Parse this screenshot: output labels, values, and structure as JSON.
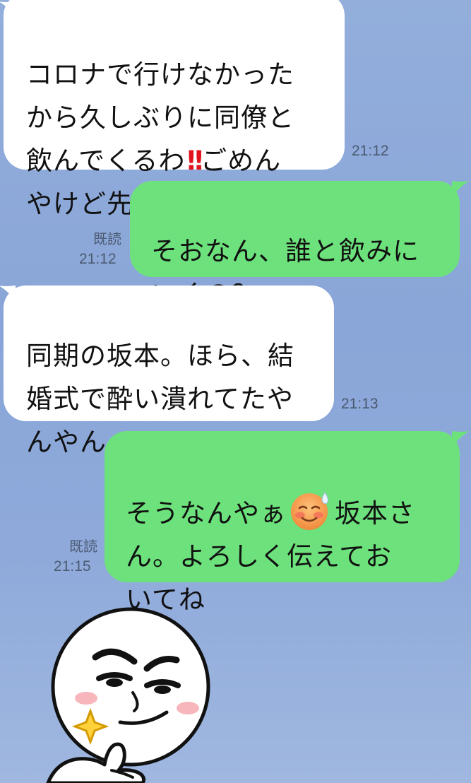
{
  "messages": [
    {
      "side": "left",
      "text_before": "コロナで行けなかった\nから久しぶりに同僚と\n飲んでくるわ",
      "emphasis": "!!",
      "text_after": "ごめん\nやけど先に寝といて",
      "time": "21:12"
    },
    {
      "side": "right",
      "text": "そおなん、誰と飲みに\nいくの？",
      "read": "既読",
      "time": "21:12"
    },
    {
      "side": "left",
      "text": "同期の坂本。ほら、結\n婚式で酔い潰れてたや\nんやん",
      "time": "21:13"
    },
    {
      "side": "right",
      "text_before": "そうなんやぁ",
      "emoji": "sweat-smile-emoji",
      "text_after": "坂本さ\nん。よろしく伝えてお\nいてね",
      "read": "既読",
      "time": "21:15"
    }
  ],
  "sticker": {
    "icon": "thumbs-up-face-sticker"
  },
  "colors": {
    "background": "#8ea9da",
    "incoming_bubble": "#ffffff",
    "outgoing_bubble": "#6de27c",
    "emphasis": "#e0141d"
  }
}
